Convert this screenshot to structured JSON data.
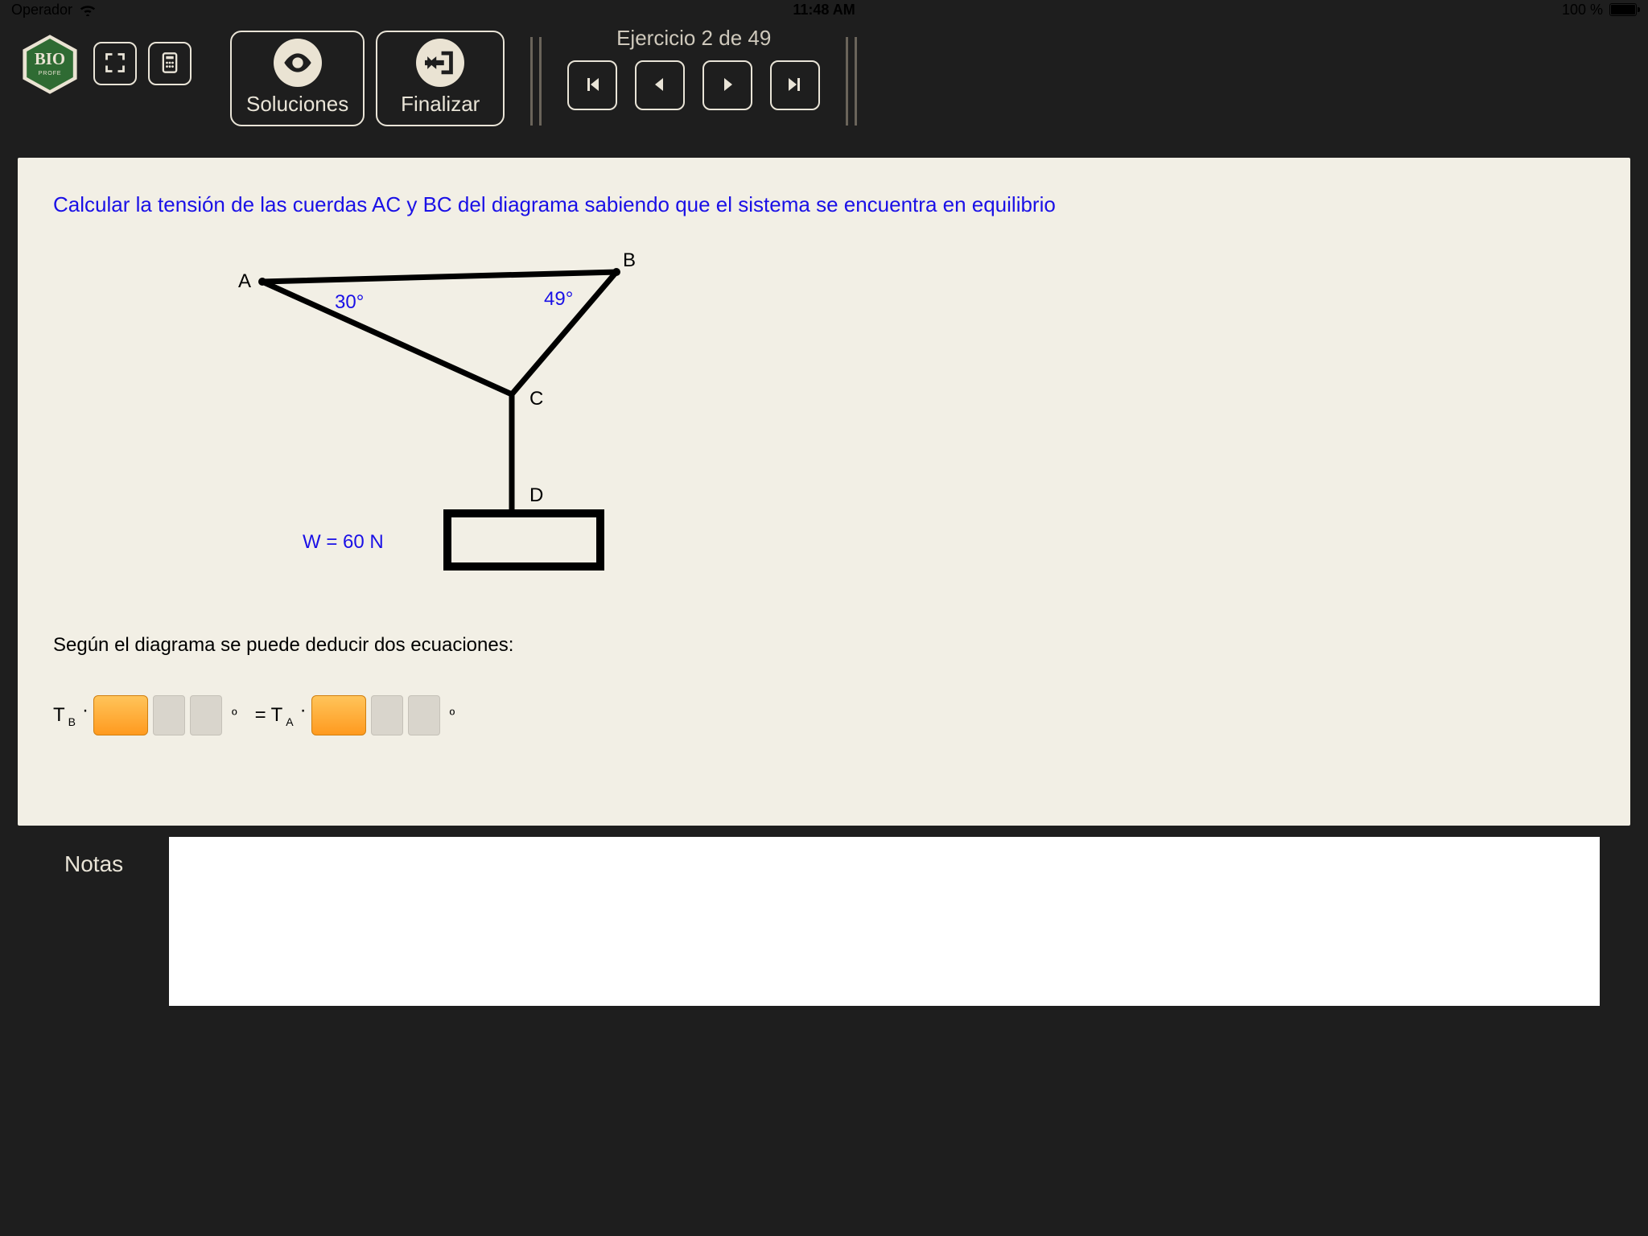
{
  "status": {
    "carrier": "Operador",
    "time": "11:48 AM",
    "battery_pct": "100 %"
  },
  "logo": {
    "line1": "BIO",
    "line2": "PROFE"
  },
  "toolbar": {
    "soluciones": "Soluciones",
    "finalizar": "Finalizar",
    "exercise_label": "Ejercicio 2 de 49"
  },
  "problem": {
    "prompt": "Calcular la tensión de las cuerdas AC y BC del diagrama sabiendo que el sistema se encuentra en equilibrio",
    "labels": {
      "A": "A",
      "B": "B",
      "C": "C",
      "D": "D"
    },
    "angles": {
      "a": "30°",
      "b": "49°"
    },
    "weight": "W = 60 N",
    "subtext": "Según el diagrama se puede deducir dos ecuaciones:",
    "eq": {
      "T": "T",
      "subB": "B",
      "subA": "A",
      "dot": "·",
      "eq": "=",
      "deg": "º"
    }
  },
  "notes": {
    "label": "Notas",
    "value": ""
  }
}
